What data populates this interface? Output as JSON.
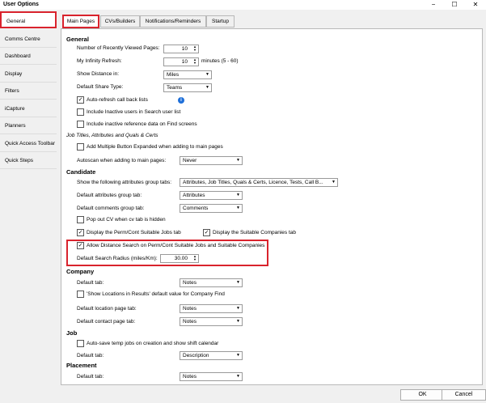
{
  "window": {
    "title": "User Options",
    "minimize": "−",
    "maximize": "☐",
    "close": "✕"
  },
  "sidebar": {
    "items": [
      {
        "label": "General"
      },
      {
        "label": "Comms Centre"
      },
      {
        "label": "Dashboard"
      },
      {
        "label": "Display"
      },
      {
        "label": "Filters"
      },
      {
        "label": "iCapture"
      },
      {
        "label": "Planners"
      },
      {
        "label": "Quick Access Toolbar"
      },
      {
        "label": "Quick Steps"
      }
    ]
  },
  "tabs": [
    {
      "label": "Main Pages"
    },
    {
      "label": "CVs/Builders"
    },
    {
      "label": "Notifications/Reminders"
    },
    {
      "label": "Startup"
    }
  ],
  "general": {
    "heading": "General",
    "recent_label": "Number of Recently Viewed Pages:",
    "recent_value": "10",
    "refresh_label": "My Infinity Refresh:",
    "refresh_value": "10",
    "refresh_suffix": "minutes (5 - 60)",
    "distance_label": "Show Distance in:",
    "distance_value": "Miles",
    "share_label": "Default Share Type:",
    "share_value": "Teams",
    "auto_refresh_label": "Auto-refresh call back lists",
    "info_icon": "i",
    "inactive_users_label": "Include Inactive users in Search user list",
    "inactive_ref_label": "Include inactive reference data on Find screens",
    "check_mark": "✓"
  },
  "job_titles": {
    "heading": "Job Titles, Attributes and Quals & Certs",
    "add_multiple_label": "Add Multiple Button Expanded when adding to main pages",
    "autoscan_label": "Autoscan when adding to main pages:",
    "autoscan_value": "Never"
  },
  "candidate": {
    "heading": "Candidate",
    "attr_groups_label": "Show the following attributes group tabs:",
    "attr_groups_value": "Attributes, Job Titles, Quals & Certs, Licence, Tests, Call B...",
    "default_attr_label": "Default attributes group tab:",
    "default_attr_value": "Attributes",
    "default_comments_label": "Default comments group tab:",
    "default_comments_value": "Comments",
    "popout_label": "Pop out CV when cv tab is hidden",
    "perm_jobs_label": "Display the Perm/Cont Suitable Jobs tab",
    "suitable_companies_label": "Display the Suitable Companies tab",
    "distance_search_label": "Allow Distance Search on Perm/Cont Suitable Jobs and Suitable Companies",
    "radius_label": "Default Search Radius (miles/Km):",
    "radius_value": "30.00"
  },
  "company": {
    "heading": "Company",
    "default_tab_label": "Default tab:",
    "default_tab_value": "Notes",
    "show_locations_label": "'Show Locations in Results' default value for Company Find",
    "location_tab_label": "Default location page tab:",
    "location_tab_value": "Notes",
    "contact_tab_label": "Default contact page tab:",
    "contact_tab_value": "Notes"
  },
  "job": {
    "heading": "Job",
    "autosave_label": "Auto-save temp jobs on creation and show shift calendar",
    "default_tab_label": "Default tab:",
    "default_tab_value": "Description"
  },
  "placement": {
    "heading": "Placement",
    "default_tab_label": "Default tab:",
    "default_tab_value": "Notes"
  },
  "footer": {
    "ok_label": "OK",
    "cancel_label": "Cancel"
  },
  "colors": {
    "highlight": "#d9232d",
    "info": "#1e6fd9"
  }
}
